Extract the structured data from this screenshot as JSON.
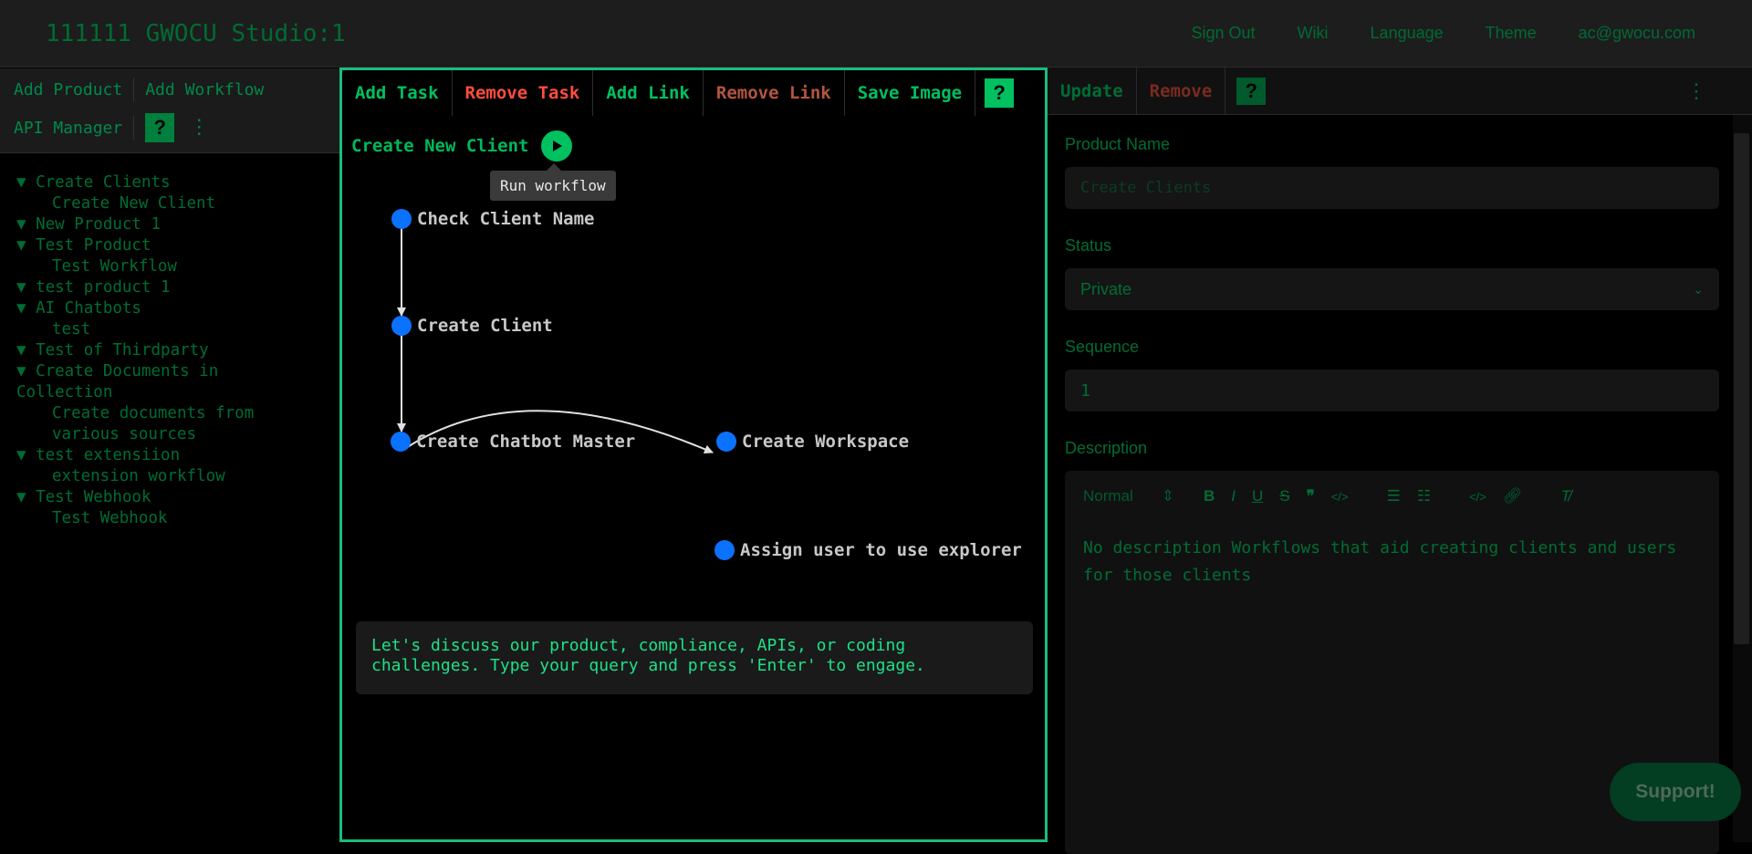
{
  "app": {
    "title": "111111 GWOCU Studio:1"
  },
  "topnav": [
    "Sign Out",
    "Wiki",
    "Language",
    "Theme",
    "ac@gwocu.com"
  ],
  "left": {
    "toolbar": {
      "add_product": "Add Product",
      "add_workflow": "Add Workflow",
      "api_manager": "API Manager",
      "help": "?"
    },
    "tree": [
      {
        "type": "product",
        "label": "▼ Create Clients"
      },
      {
        "type": "workflow",
        "label": "Create New Client"
      },
      {
        "type": "product",
        "label": "▼ New Product 1"
      },
      {
        "type": "product",
        "label": "▼ Test Product"
      },
      {
        "type": "workflow",
        "label": "Test Workflow"
      },
      {
        "type": "product",
        "label": "▼ test product 1"
      },
      {
        "type": "product",
        "label": "▼ AI Chatbots"
      },
      {
        "type": "workflow",
        "label": "test"
      },
      {
        "type": "product",
        "label": "▼ Test of Thirdparty"
      },
      {
        "type": "product",
        "label": "▼ Create Documents in Collection"
      },
      {
        "type": "workflow",
        "label": "Create documents from various sources"
      },
      {
        "type": "product",
        "label": "▼ test extensiion"
      },
      {
        "type": "workflow",
        "label": "extension workflow"
      },
      {
        "type": "product",
        "label": "▼ Test Webhook"
      },
      {
        "type": "workflow",
        "label": "Test Webhook"
      }
    ]
  },
  "center": {
    "toolbar": {
      "add_task": "Add Task",
      "remove_task": "Remove Task",
      "add_link": "Add Link",
      "remove_link": "Remove Link",
      "save_image": "Save Image",
      "help": "?"
    },
    "workflow_title": "Create New Client",
    "tooltip": "Run workflow",
    "nodes": {
      "check_client_name": "Check Client Name",
      "create_client": "Create Client",
      "create_chatbot_master": "Create Chatbot Master",
      "create_workspace": "Create Workspace",
      "assign_user": "Assign user to use explorer"
    },
    "chat_prompt": "Let's discuss our product, compliance, APIs, or coding challenges. Type your query and press 'Enter' to engage."
  },
  "right": {
    "toolbar": {
      "update": "Update",
      "remove": "Remove",
      "help": "?"
    },
    "product_name_label": "Product Name",
    "product_name_placeholder": "Create Clients",
    "status_label": "Status",
    "status_value": "Private",
    "sequence_label": "Sequence",
    "sequence_value": "1",
    "description_label": "Description",
    "editor_format": "Normal",
    "description_text": "No description Workflows that aid creating clients and users for those clients"
  },
  "support_button": "Support!"
}
